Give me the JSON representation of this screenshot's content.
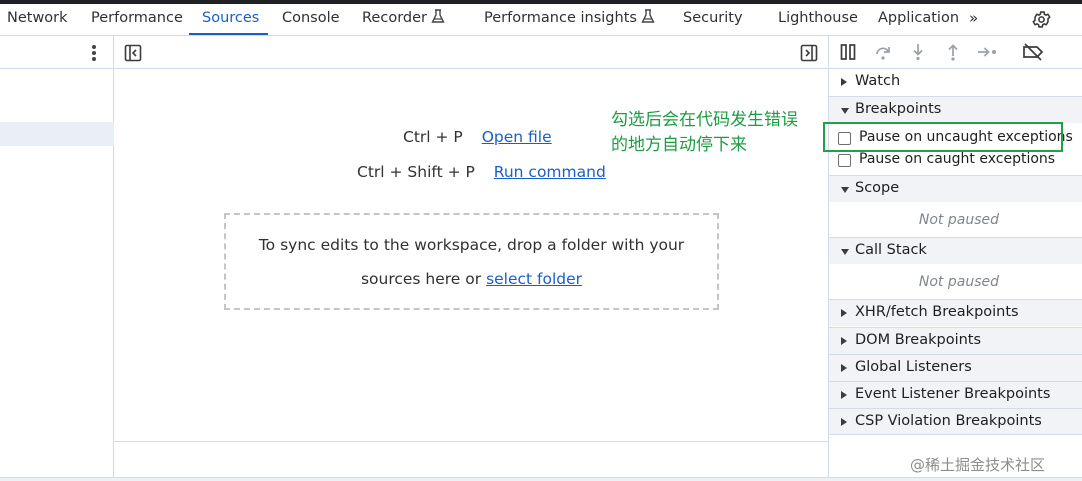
{
  "tabs": [
    {
      "label": "Network"
    },
    {
      "label": "Performance"
    },
    {
      "label": "Sources"
    },
    {
      "label": "Console"
    },
    {
      "label": "Recorder"
    },
    {
      "label": "Performance insights"
    },
    {
      "label": "Security"
    },
    {
      "label": "Lighthouse"
    },
    {
      "label": "Application"
    }
  ],
  "active_tab": "Sources",
  "more_tabs": "»",
  "editor": {
    "open_file_keys": "Ctrl + P",
    "open_file_link": "Open file",
    "run_command_keys": "Ctrl + Shift + P",
    "run_command_link": "Run command",
    "drop_text_line1": "To sync edits to the workspace, drop a folder with your",
    "drop_text_line2": "sources here or",
    "select_folder_link": "select folder"
  },
  "sidebar": {
    "watch": "Watch",
    "breakpoints": "Breakpoints",
    "pause_uncaught": "Pause on uncaught exceptions",
    "pause_caught": "Pause on caught exceptions",
    "scope": "Scope",
    "scope_status": "Not paused",
    "call_stack": "Call Stack",
    "call_stack_status": "Not paused",
    "xhr_breakpoints": "XHR/fetch Breakpoints",
    "dom_breakpoints": "DOM Breakpoints",
    "global_listeners": "Global Listeners",
    "event_listener_breakpoints": "Event Listener Breakpoints",
    "csp_breakpoints": "CSP Violation Breakpoints"
  },
  "annotation": {
    "line1": "勾选后会在代码发生错误",
    "line2": "的地方自动停下来"
  },
  "watermark": "@稀土掘金技术社区",
  "colors": {
    "accent": "#1a5fc9",
    "annotation": "#1e9c43"
  }
}
